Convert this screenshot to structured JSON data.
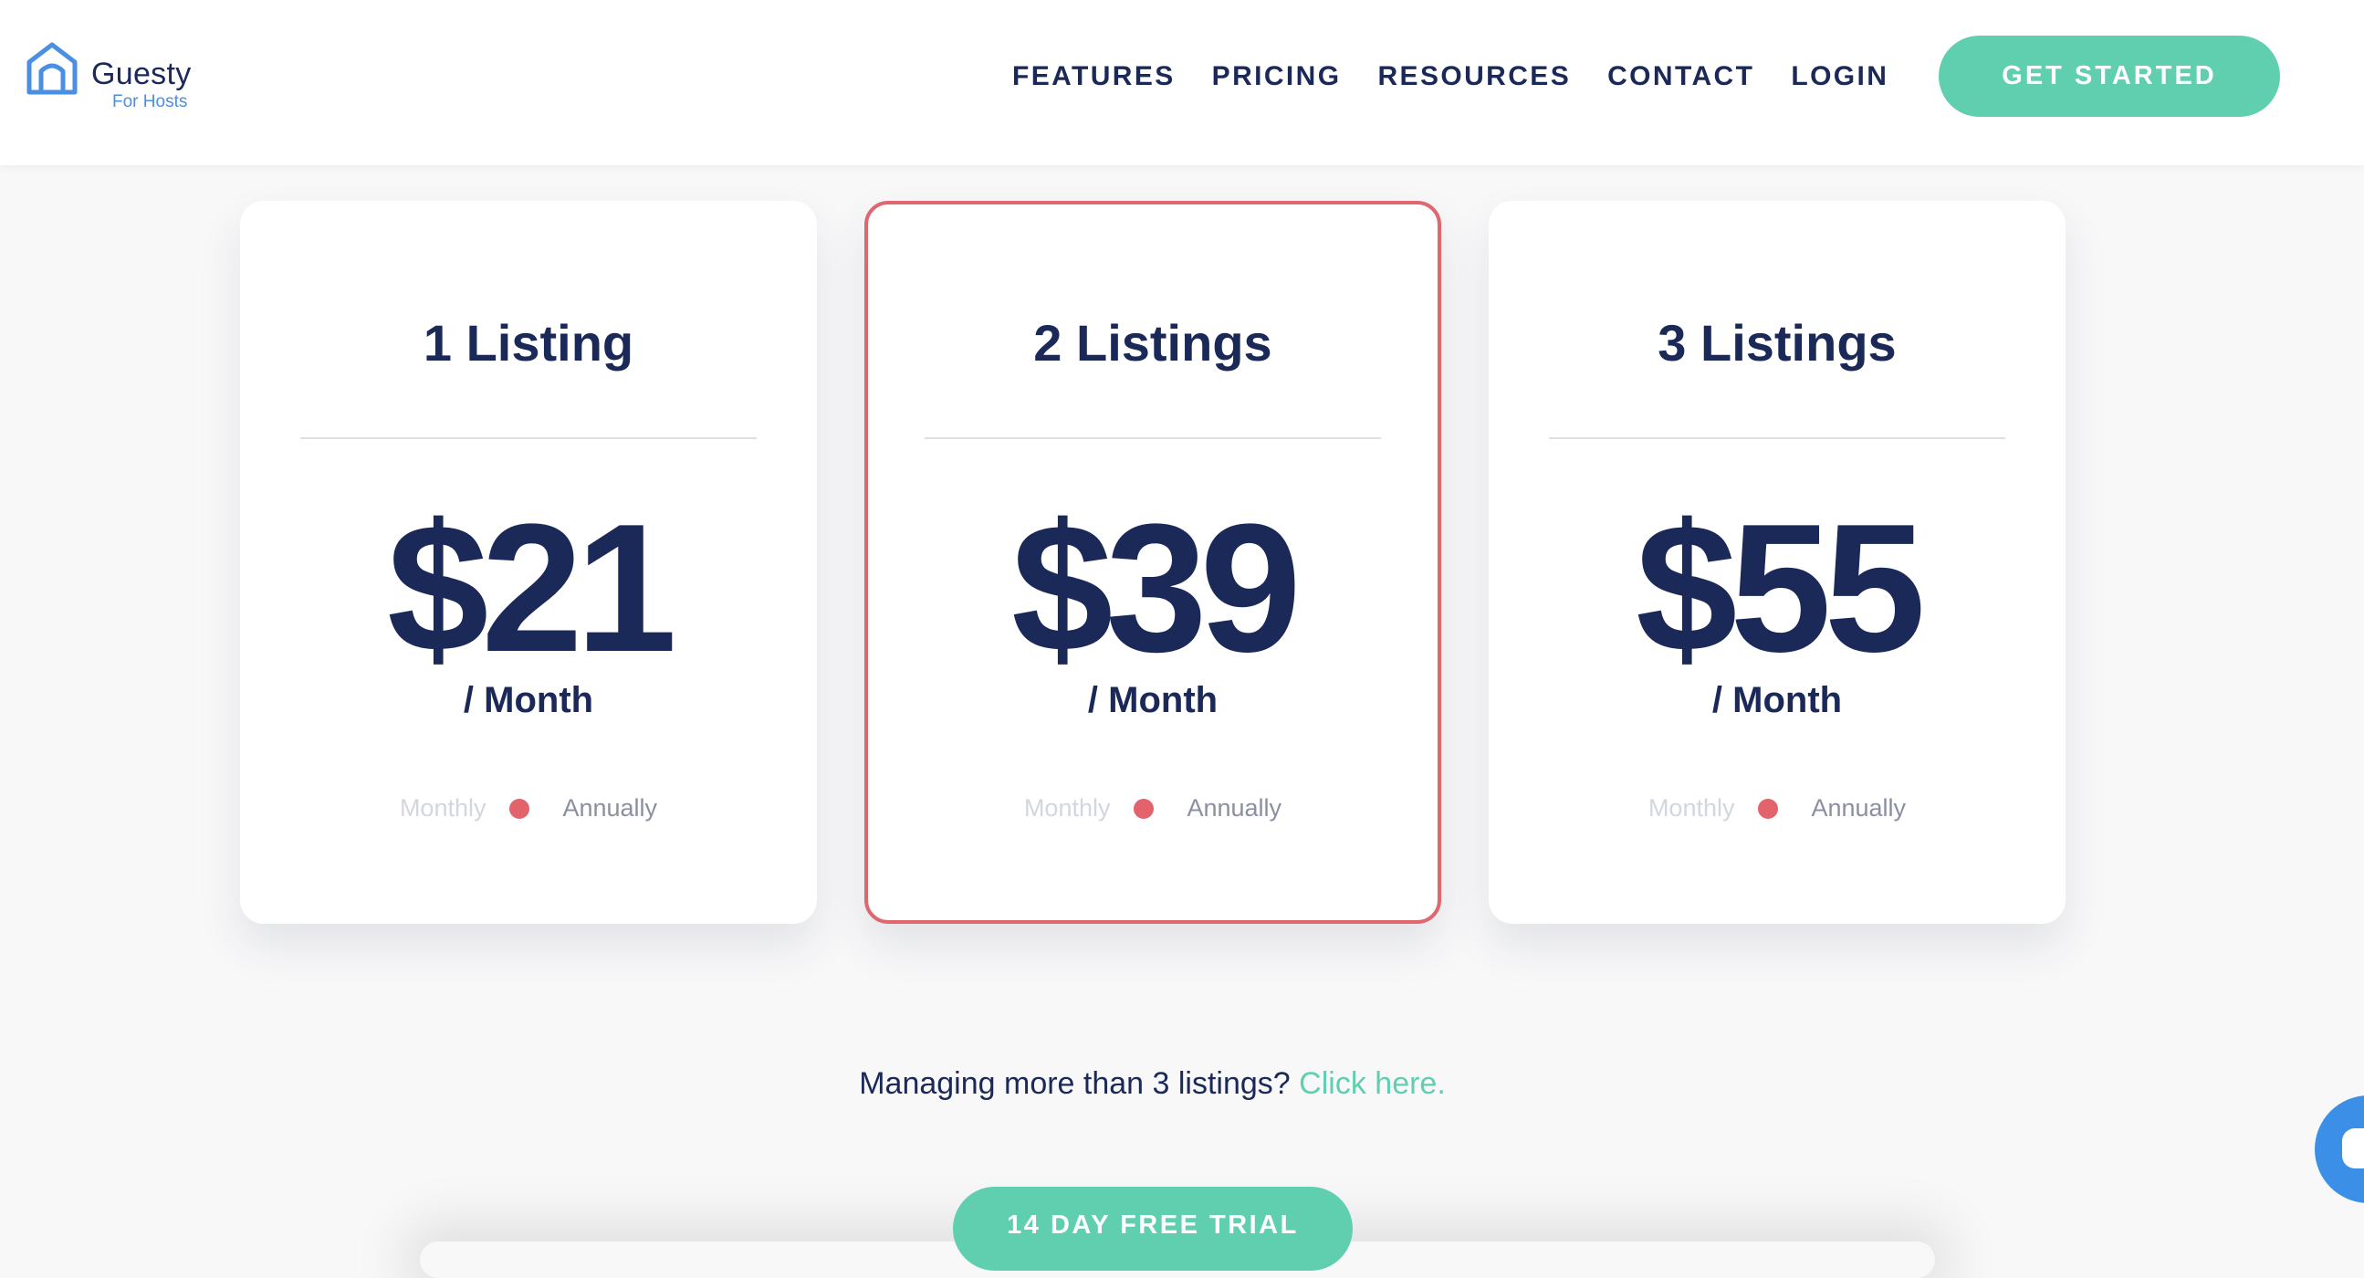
{
  "colors": {
    "brand_navy": "#1b2958",
    "accent_teal": "#5fcfb0",
    "featured_border": "#e06770",
    "logo_blue": "#4a8fe2",
    "chat_blue": "#3b8fe6"
  },
  "header": {
    "logo": {
      "icon": "house-icon",
      "name": "Guesty",
      "subtitle": "For Hosts"
    },
    "nav": [
      "FEATURES",
      "PRICING",
      "RESOURCES",
      "CONTACT",
      "LOGIN"
    ],
    "cta_label": "GET STARTED"
  },
  "plans": [
    {
      "title": "1 Listing",
      "price": "$21",
      "period": "/ Month",
      "toggle": {
        "monthly": "Monthly",
        "annually": "Annually"
      },
      "featured": false
    },
    {
      "title": "2 Listings",
      "price": "$39",
      "period": "/ Month",
      "toggle": {
        "monthly": "Monthly",
        "annually": "Annually"
      },
      "featured": true
    },
    {
      "title": "3 Listings",
      "price": "$55",
      "period": "/ Month",
      "toggle": {
        "monthly": "Monthly",
        "annually": "Annually"
      },
      "featured": false
    }
  ],
  "more": {
    "text": "Managing more than 3 listings?",
    "link": "Click here."
  },
  "trial_label": "14 DAY FREE TRIAL",
  "chat": {
    "icon": "chat-bubble-icon"
  }
}
